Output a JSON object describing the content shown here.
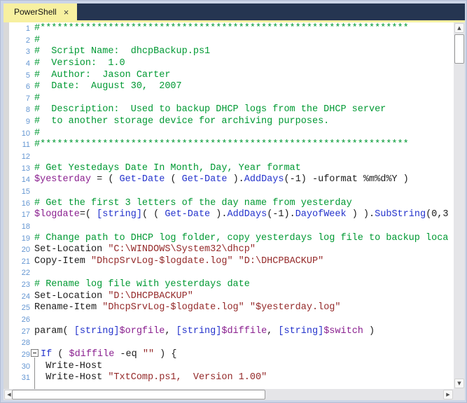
{
  "colors": {
    "frame": "#ccd5e7",
    "tabbar_bg": "#253551",
    "tab_bg": "#f7f0a0",
    "editor_bg": "#ffffff",
    "margin_strip": "#d9d9d9",
    "line_number": "#6496d2",
    "comment": "#009933",
    "string": "#942929",
    "variable": "#8a1f8f",
    "keyword": "#2433cc",
    "plain": "#1c1c1c",
    "scroll_track": "#e5e5e8",
    "arrow": "#4f4f4f"
  },
  "tab": {
    "label": "PowerShell",
    "close_icon": "×"
  },
  "icons": {
    "scroll_up": "▲",
    "scroll_down": "▼",
    "scroll_left": "◀",
    "scroll_right": "▶"
  },
  "editor": {
    "lines": [
      {
        "n": 1,
        "s": [
          [
            "#*****************************************************************",
            "cm"
          ]
        ]
      },
      {
        "n": 2,
        "s": [
          [
            "#",
            "cm"
          ]
        ]
      },
      {
        "n": 3,
        "s": [
          [
            "#  Script Name:  dhcpBackup.ps1",
            "cm"
          ]
        ]
      },
      {
        "n": 4,
        "s": [
          [
            "#  Version:  1.0",
            "cm"
          ]
        ]
      },
      {
        "n": 5,
        "s": [
          [
            "#  Author:  Jason Carter",
            "cm"
          ]
        ]
      },
      {
        "n": 6,
        "s": [
          [
            "#  Date:  August 30,  2007",
            "cm"
          ]
        ]
      },
      {
        "n": 7,
        "s": [
          [
            "#",
            "cm"
          ]
        ]
      },
      {
        "n": 8,
        "s": [
          [
            "#  Description:  Used to backup DHCP logs from the DHCP server",
            "cm"
          ]
        ]
      },
      {
        "n": 9,
        "s": [
          [
            "#  to another storage device for archiving purposes.",
            "cm"
          ]
        ]
      },
      {
        "n": 10,
        "s": [
          [
            "#",
            "cm"
          ]
        ]
      },
      {
        "n": 11,
        "s": [
          [
            "#*****************************************************************",
            "cm"
          ]
        ]
      },
      {
        "n": 12,
        "s": []
      },
      {
        "n": 13,
        "s": [
          [
            "# Get Yestedays Date In Month, Day, Year format",
            "cm"
          ]
        ]
      },
      {
        "n": 14,
        "s": [
          [
            "$yesterday",
            "vr"
          ],
          [
            " = ( ",
            "pl"
          ],
          [
            "Get-Date",
            "kw"
          ],
          [
            " ( ",
            "pl"
          ],
          [
            "Get-Date",
            "kw"
          ],
          [
            " ).",
            "pl"
          ],
          [
            "AddDays",
            "kw"
          ],
          [
            "(-1) -uformat %m%d%Y )",
            "pl"
          ]
        ]
      },
      {
        "n": 15,
        "s": []
      },
      {
        "n": 16,
        "s": [
          [
            "# Get the first 3 letters of the day name from yesterday",
            "cm"
          ]
        ]
      },
      {
        "n": 17,
        "s": [
          [
            "$logdate",
            "vr"
          ],
          [
            "=( ",
            "pl"
          ],
          [
            "[string]",
            "kw"
          ],
          [
            "( ( ",
            "pl"
          ],
          [
            "Get-Date",
            "kw"
          ],
          [
            " ).",
            "pl"
          ],
          [
            "AddDays",
            "kw"
          ],
          [
            "(-1).",
            "pl"
          ],
          [
            "DayofWeek",
            "kw"
          ],
          [
            " ) ).",
            "pl"
          ],
          [
            "SubString",
            "kw"
          ],
          [
            "(0,3",
            "pl"
          ]
        ]
      },
      {
        "n": 18,
        "s": []
      },
      {
        "n": 19,
        "s": [
          [
            "# Change path to DHCP log folder, copy yesterdays log file to backup loca",
            "cm"
          ]
        ]
      },
      {
        "n": 20,
        "s": [
          [
            "Set-Location ",
            "pl"
          ],
          [
            "\"C:\\WINDOWS\\System32\\dhcp\"",
            "st"
          ]
        ]
      },
      {
        "n": 21,
        "s": [
          [
            "Copy-Item ",
            "pl"
          ],
          [
            "\"DhcpSrvLog-$logdate.log\"",
            "st"
          ],
          [
            " ",
            "pl"
          ],
          [
            "\"D:\\DHCPBACKUP\"",
            "st"
          ]
        ]
      },
      {
        "n": 22,
        "s": []
      },
      {
        "n": 23,
        "s": [
          [
            "# Rename log file with yesterdays date",
            "cm"
          ]
        ]
      },
      {
        "n": 24,
        "s": [
          [
            "Set-Location ",
            "pl"
          ],
          [
            "\"D:\\DHCPBACKUP\"",
            "st"
          ]
        ]
      },
      {
        "n": 25,
        "s": [
          [
            "Rename-Item ",
            "pl"
          ],
          [
            "\"DhcpSrvLog-$logdate.log\"",
            "st"
          ],
          [
            " ",
            "pl"
          ],
          [
            "\"$yesterday.log\"",
            "st"
          ]
        ]
      },
      {
        "n": 26,
        "s": []
      },
      {
        "n": 27,
        "s": [
          [
            "param( ",
            "pl"
          ],
          [
            "[string]",
            "kw"
          ],
          [
            "$orgfile",
            "vr"
          ],
          [
            ", ",
            "pl"
          ],
          [
            "[string]",
            "kw"
          ],
          [
            "$diffile",
            "vr"
          ],
          [
            ", ",
            "pl"
          ],
          [
            "[string]",
            "kw"
          ],
          [
            "$switch",
            "vr"
          ],
          [
            " )",
            "pl"
          ]
        ]
      },
      {
        "n": 28,
        "s": []
      },
      {
        "n": 29,
        "fold": true,
        "s": [
          [
            "If",
            "kw"
          ],
          [
            " ( ",
            "pl"
          ],
          [
            "$diffile",
            "vr"
          ],
          [
            " -eq ",
            "pl"
          ],
          [
            "\"\"",
            "st"
          ],
          [
            " ) {",
            "pl"
          ]
        ]
      },
      {
        "n": 30,
        "s": [
          [
            "  Write-Host",
            "pl"
          ]
        ]
      },
      {
        "n": 31,
        "s": [
          [
            "  Write-Host ",
            "pl"
          ],
          [
            "\"TxtComp.ps1,  Version 1.00\"",
            "st"
          ]
        ]
      }
    ]
  }
}
